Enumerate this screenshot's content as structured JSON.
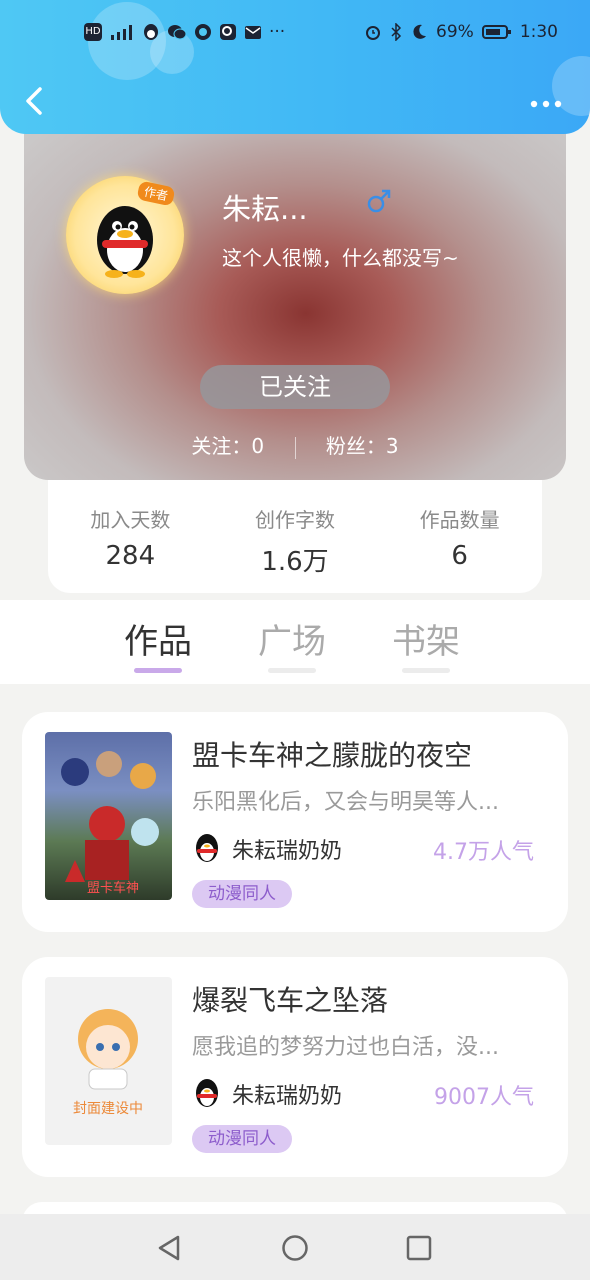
{
  "status_bar": {
    "left_icons": [
      "hd-icon",
      "signal-icon",
      "qq-icon",
      "wechat-icon",
      "browser-icon",
      "search-app-icon",
      "mail-icon"
    ],
    "more": "···",
    "battery": "69%",
    "time": "1:30"
  },
  "profile": {
    "avatar_tag": "作者",
    "name": "朱耘...",
    "gender_symbol": "♂",
    "bio": "这个人很懒，什么都没写~",
    "follow_button": "已关注",
    "following": "关注：0",
    "fans": "粉丝：3"
  },
  "stats": [
    {
      "label": "加入天数",
      "value": "284"
    },
    {
      "label": "创作字数",
      "value": "1.6万"
    },
    {
      "label": "作品数量",
      "value": "6"
    }
  ],
  "tabs": [
    "作品",
    "广场",
    "书架"
  ],
  "works": [
    {
      "title": "盟卡车神之朦胧的夜空",
      "desc": "乐阳黑化后，又会与明昊等人...",
      "author": "朱耘瑞奶奶",
      "popularity": "4.7万人气",
      "tag": "动漫同人",
      "cover_text": "盟卡车神"
    },
    {
      "title": "爆裂飞车之坠落",
      "desc": "愿我追的梦努力过也白活，没...",
      "author": "朱耘瑞奶奶",
      "popularity": "9007人气",
      "tag": "动漫同人",
      "cover_text": "封面建设中"
    }
  ],
  "colors": {
    "accent": "#c4a2e8",
    "topbar": "#41b8f5"
  }
}
